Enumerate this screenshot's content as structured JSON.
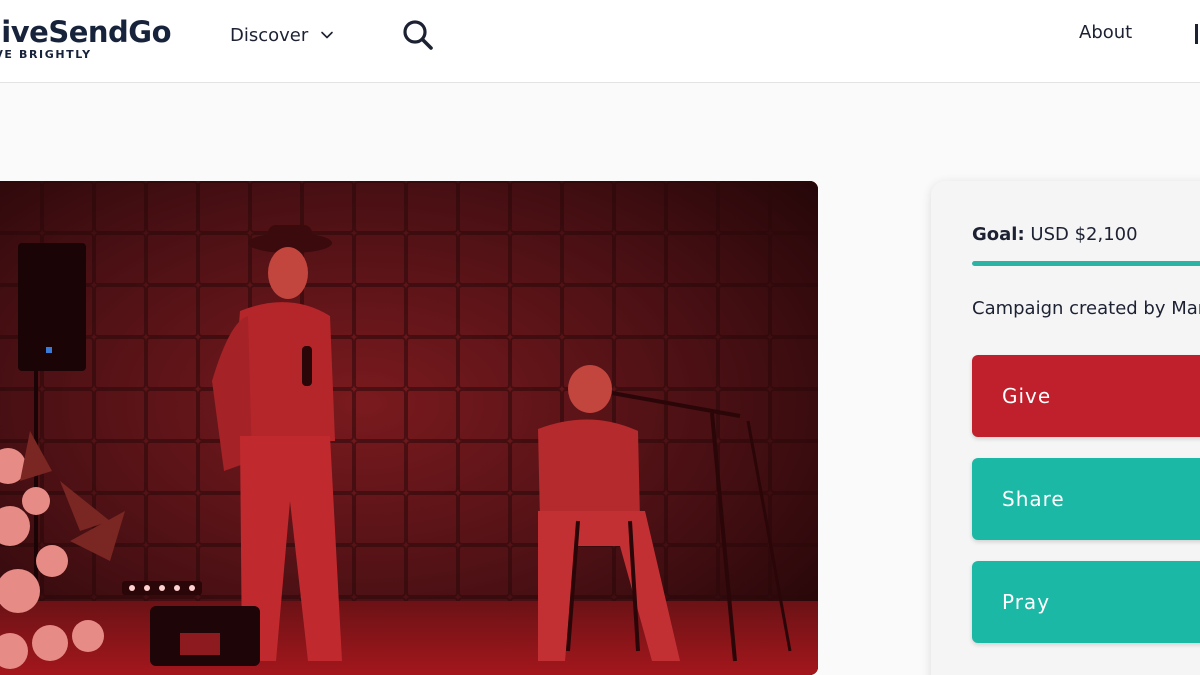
{
  "header": {
    "logo_text": "GiveSendGo",
    "logo_tagline": "GIVE BRIGHTLY",
    "nav_discover": "Discover",
    "nav_about": "About"
  },
  "icons": [
    "chevron-down-icon",
    "search-icon"
  ],
  "campaign": {
    "goal_label": "Goal:",
    "goal_value": "USD $2,100",
    "goal_progress_fraction": 1.0,
    "created_by_text": "Campaign created by Mar",
    "buttons": {
      "give": "Give",
      "share": "Share",
      "pray": "Pray"
    }
  },
  "colors": {
    "give": "#c0202b",
    "share": "#1bb8a6",
    "pray": "#1bb8a6",
    "progress": "#2bb3a6",
    "text": "#1d2233"
  }
}
